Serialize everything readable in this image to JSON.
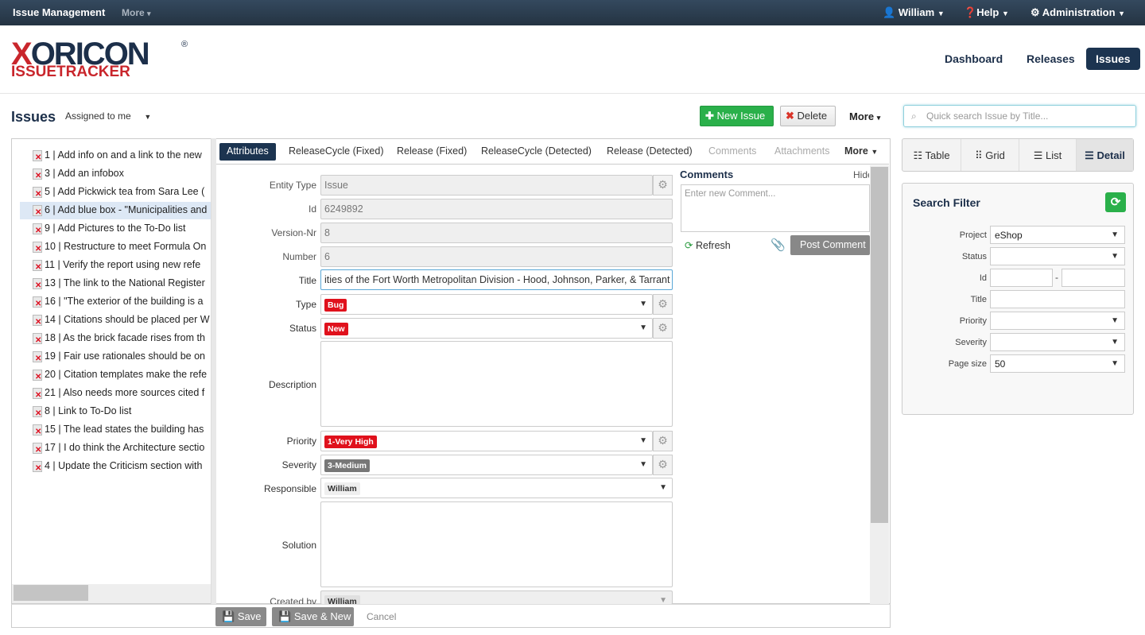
{
  "topbar": {
    "brand": "Issue Management",
    "more": "More",
    "user": "William",
    "help": "Help",
    "admin": "Administration"
  },
  "logo": {
    "line1_x": "X",
    "line1_rest": "ORICON",
    "line2": "ISSUETRACKER",
    "reg": "®"
  },
  "nav": {
    "dashboard": "Dashboard",
    "releases": "Releases",
    "issues": "Issues"
  },
  "page": {
    "title": "Issues",
    "view_select": "Assigned to me",
    "new_issue": "New Issue",
    "delete": "Delete",
    "more": "More",
    "search_placeholder": "Quick search Issue by Title..."
  },
  "issue_list": [
    {
      "label": "1 | Add info on and a link to the new"
    },
    {
      "label": "3 | Add an infobox"
    },
    {
      "label": "5 | Add Pickwick tea from Sara Lee ("
    },
    {
      "label": "6 | Add blue box - \"Municipalities and"
    },
    {
      "label": "9 | Add Pictures to the To-Do list"
    },
    {
      "label": "10 | Restructure to meet Formula On"
    },
    {
      "label": "11 | Verify the report using new refe"
    },
    {
      "label": "13 | The link to the National Register"
    },
    {
      "label": "16 | \"The exterior of the building is a"
    },
    {
      "label": "14 | Citations should be placed per W"
    },
    {
      "label": "18 | As the brick facade rises from th"
    },
    {
      "label": "19 | Fair use rationales should be on"
    },
    {
      "label": "20 | Citation templates make the refe"
    },
    {
      "label": "21 | Also needs more sources cited f"
    },
    {
      "label": "8 | Link to To-Do list"
    },
    {
      "label": "15 | The lead states the building has"
    },
    {
      "label": "17 | I do think the Architecture sectio"
    },
    {
      "label": "4 | Update the Criticism section with"
    }
  ],
  "tabs": {
    "attributes": "Attributes",
    "rc_fixed": "ReleaseCycle (Fixed)",
    "rel_fixed": "Release (Fixed)",
    "rc_detected": "ReleaseCycle (Detected)",
    "rel_detected": "Release (Detected)",
    "comments": "Comments",
    "attachments": "Attachments",
    "more": "More"
  },
  "form": {
    "entity_type_label": "Entity Type",
    "entity_type": "Issue",
    "id_label": "Id",
    "id": "6249892",
    "version_label": "Version-Nr",
    "version": "8",
    "number_label": "Number",
    "number": "6",
    "title_label": "Title",
    "title": "ities of the Fort Worth Metropolitan Division - Hood, Johnson, Parker, & Tarrant",
    "type_label": "Type",
    "type": "Bug",
    "status_label": "Status",
    "status": "New",
    "description_label": "Description",
    "priority_label": "Priority",
    "priority": "1-Very High",
    "severity_label": "Severity",
    "severity": "3-Medium",
    "responsible_label": "Responsible",
    "responsible": "William",
    "solution_label": "Solution",
    "created_by_label": "Created by",
    "created_by": "William"
  },
  "comments": {
    "heading": "Comments",
    "hide": "Hide",
    "placeholder": "Enter new Comment...",
    "refresh": "Refresh",
    "post": "Post Comment"
  },
  "bottom": {
    "save": "Save",
    "save_new": "Save & New",
    "cancel": "Cancel"
  },
  "views": {
    "table": "Table",
    "grid": "Grid",
    "list": "List",
    "detail": "Detail"
  },
  "filter": {
    "heading": "Search Filter",
    "project_label": "Project",
    "project": "eShop",
    "status_label": "Status",
    "id_label": "Id",
    "id_sep": "-",
    "title_label": "Title",
    "priority_label": "Priority",
    "severity_label": "Severity",
    "page_size_label": "Page size",
    "page_size": "50"
  },
  "colors": {
    "nav_dark": "#1c3450",
    "green": "#2ab04a",
    "red_badge": "#e0111c",
    "logo_red": "#c9262c",
    "grey_badge": "#777777"
  }
}
